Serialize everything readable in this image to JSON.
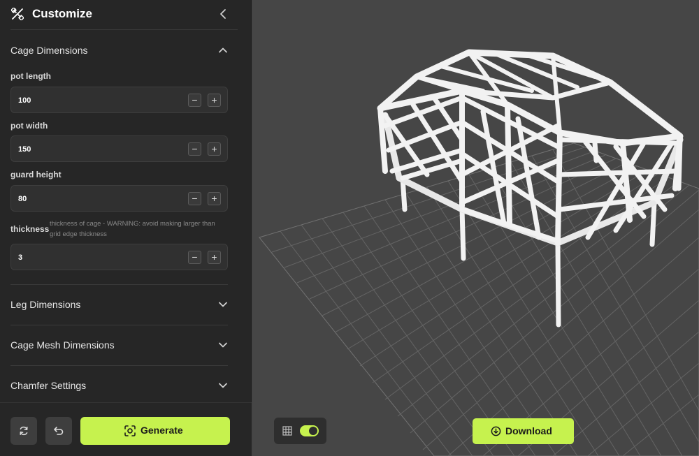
{
  "sidebar": {
    "title": "Customize",
    "title_icon": "wand-ruler-icon",
    "sections": {
      "cage_dimensions": {
        "label": "Cage Dimensions",
        "expanded": true,
        "fields": {
          "pot_length": {
            "label": "pot length",
            "value": "100"
          },
          "pot_width": {
            "label": "pot width",
            "value": "150"
          },
          "guard_height": {
            "label": "guard height",
            "value": "80"
          },
          "thickness": {
            "label": "thickness",
            "note": "thickness of cage - WARNING: avoid making larger than grid edge thickness",
            "value": "3"
          }
        }
      },
      "leg_dimensions": {
        "label": "Leg Dimensions",
        "expanded": false
      },
      "cage_mesh_dimensions": {
        "label": "Cage Mesh Dimensions",
        "expanded": false
      },
      "chamfer_settings": {
        "label": "Chamfer Settings",
        "expanded": false
      }
    },
    "stepper": {
      "minus": "−",
      "plus": "+"
    }
  },
  "footer": {
    "reset_icon": "refresh-icon",
    "undo_icon": "undo-icon",
    "generate_label": "Generate"
  },
  "viewport": {
    "grid_toggle_on": true,
    "download_label": "Download"
  },
  "colors": {
    "accent": "#c6f24e",
    "sidebar_bg": "#262626",
    "viewport_bg": "#464646"
  }
}
